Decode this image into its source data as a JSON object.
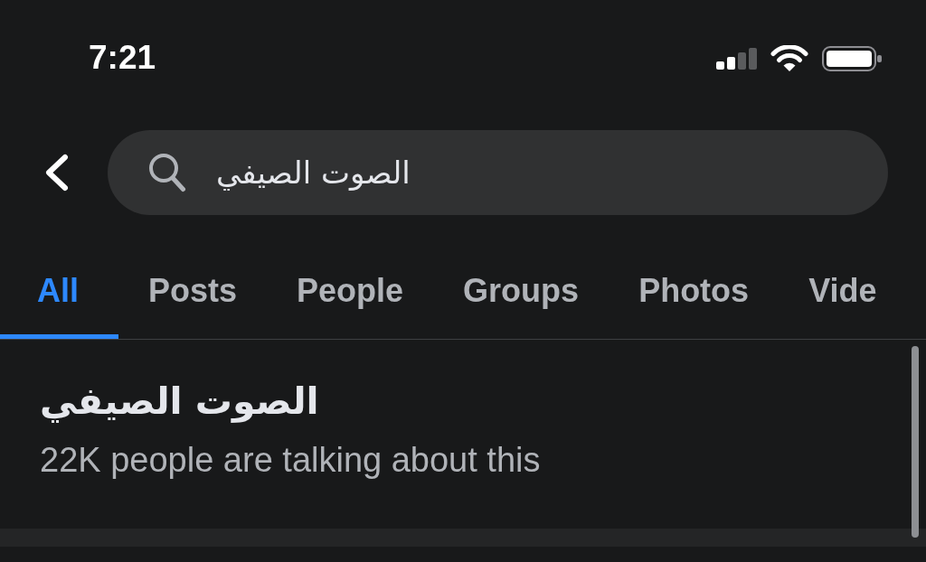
{
  "status_bar": {
    "time": "7:21"
  },
  "search": {
    "value": "الصوت الصيفي"
  },
  "tabs": [
    {
      "label": "All",
      "selected": true
    },
    {
      "label": "Posts",
      "selected": false
    },
    {
      "label": "People",
      "selected": false
    },
    {
      "label": "Groups",
      "selected": false
    },
    {
      "label": "Photos",
      "selected": false
    },
    {
      "label": "Vide",
      "selected": false
    }
  ],
  "results": [
    {
      "title": "الصوت الصيفي",
      "subtitle": "22K people are talking about this"
    }
  ]
}
